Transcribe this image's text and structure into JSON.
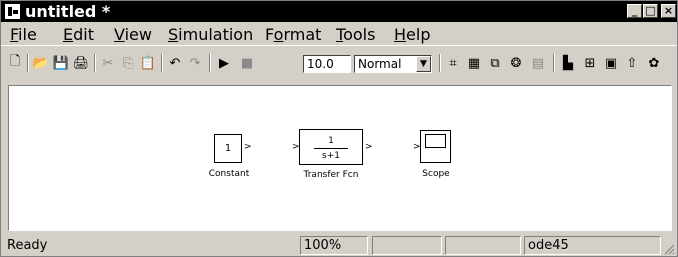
{
  "window": {
    "title": "untitled *"
  },
  "caption_buttons": {
    "minimize": "_",
    "maximize": "□",
    "close": "×"
  },
  "menu": [
    "File",
    "Edit",
    "View",
    "Simulation",
    "Format",
    "Tools",
    "Help"
  ],
  "toolbar": {
    "stop_time": "10.0",
    "sim_mode": "Normal",
    "icons": [
      "new-model",
      "open",
      "save",
      "print",
      "cut",
      "copy",
      "paste",
      "undo",
      "redo",
      "start-simulation",
      "stop-simulation",
      "build",
      "update-diagram",
      "build-subsystem",
      "library-browser",
      "model-browser",
      "debugger",
      "model-explorer",
      "go-to-parent",
      "toggle"
    ]
  },
  "blocks": {
    "constant": {
      "value": "1",
      "label": "Constant"
    },
    "transfer_fcn": {
      "numerator": "1",
      "denominator": "s+1",
      "label": "Transfer Fcn"
    },
    "scope": {
      "label": "Scope"
    }
  },
  "status": {
    "state": "Ready",
    "zoom": "100%",
    "solver": "ode45"
  }
}
